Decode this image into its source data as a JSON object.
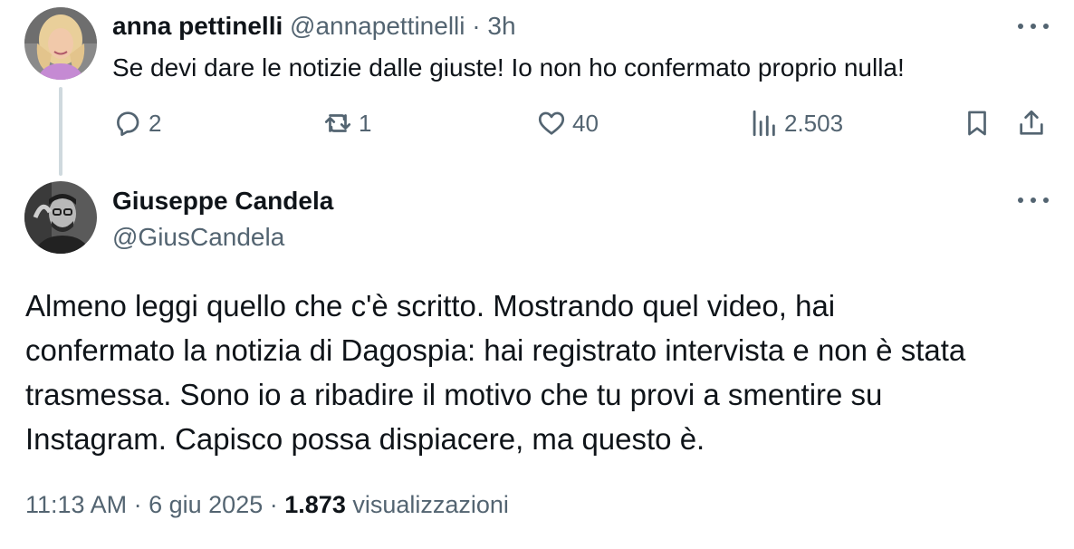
{
  "reply": {
    "name": "anna pettinelli",
    "handle": "@annapettinelli",
    "separator": "·",
    "time": "3h",
    "text": "Se devi dare le notizie dalle giuste! Io non ho confermato proprio nulla!",
    "actions": {
      "replies": "2",
      "retweets": "1",
      "likes": "40",
      "views": "2.503"
    },
    "icons": [
      "reply-icon",
      "retweet-icon",
      "like-icon",
      "views-icon",
      "bookmark-icon",
      "share-icon",
      "more-icon"
    ]
  },
  "main": {
    "name": "Giuseppe Candela",
    "handle": "@GiusCandela",
    "text_lines": [
      "Almeno leggi quello che c'è scritto. Mostrando quel video, hai",
      "confermato la notizia di Dagospia: hai registrato intervista e non è stata",
      "trasmessa. Sono io a ribadire il motivo che tu provi a smentire su",
      "Instagram. Capisco possa dispiacere, ma questo è."
    ],
    "time": "11:13 AM",
    "separator": "·",
    "date": "6 giu 2025",
    "views_count": "1.873",
    "views_label": "visualizzazioni"
  },
  "colors": {
    "text_primary": "#0f1419",
    "text_secondary": "#536471",
    "thread_line": "#cfd9de"
  }
}
